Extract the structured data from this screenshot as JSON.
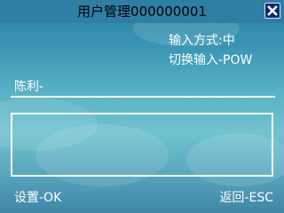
{
  "header": {
    "title": "用户管理000000001",
    "close_icon": "close-icon"
  },
  "input_info": {
    "mode": "输入方式:中",
    "switch_hint": "切换输入-POW"
  },
  "form": {
    "name_value": "陈利-",
    "textarea_value": ""
  },
  "softkeys": {
    "left": "设置-OK",
    "right": "返回-ESC"
  },
  "colors": {
    "title_bar": "#2f7fa4",
    "close_button": "#0a2a6a",
    "text": "#ffffff"
  }
}
